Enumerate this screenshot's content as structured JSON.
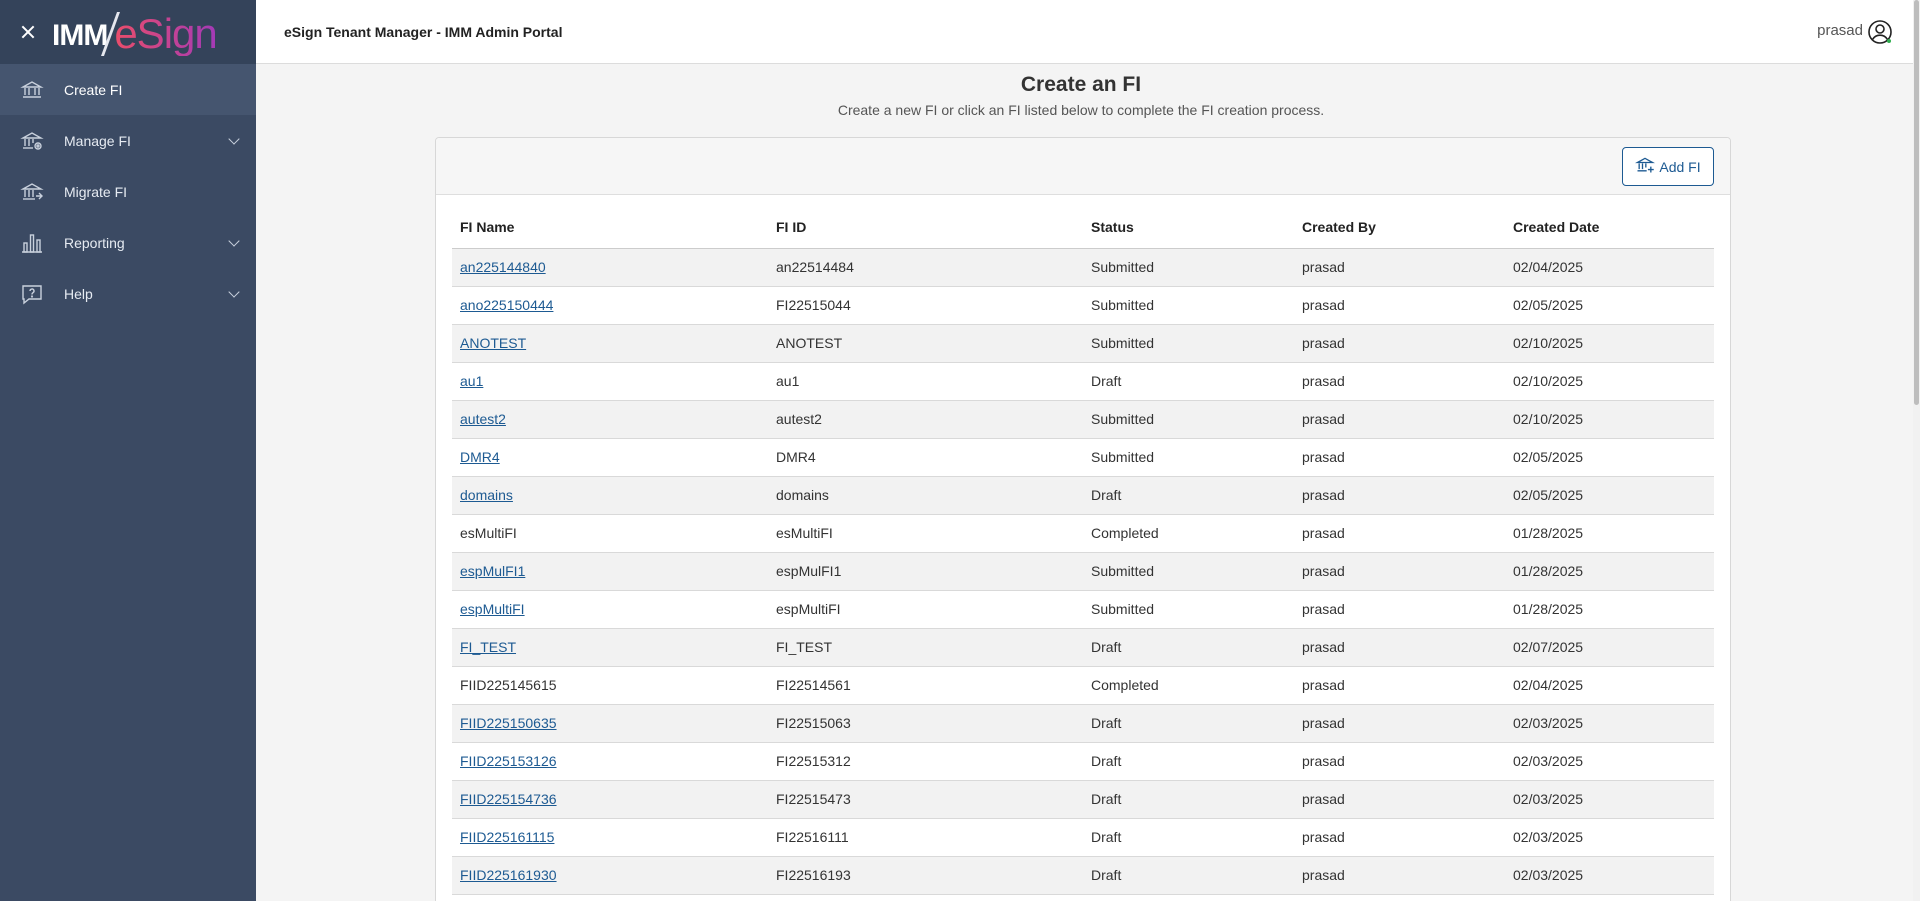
{
  "header": {
    "title": "eSign Tenant Manager - IMM Admin Portal",
    "user": "prasad"
  },
  "logo": {
    "imm": "IMM",
    "esign": "eSign"
  },
  "sidebar": {
    "items": [
      {
        "label": "Create FI",
        "icon": "bank-icon",
        "expandable": false
      },
      {
        "label": "Manage FI",
        "icon": "bank-gear-icon",
        "expandable": true
      },
      {
        "label": "Migrate FI",
        "icon": "bank-arrow-icon",
        "expandable": false
      },
      {
        "label": "Reporting",
        "icon": "bar-chart-icon",
        "expandable": true
      },
      {
        "label": "Help",
        "icon": "help-icon",
        "expandable": true
      }
    ]
  },
  "main": {
    "title": "Create an FI",
    "subtitle": "Create a new FI or click an FI listed below to complete the FI creation process.",
    "add_button": "Add FI"
  },
  "table": {
    "columns": [
      "FI Name",
      "FI ID",
      "Status",
      "Created By",
      "Created Date"
    ],
    "rows": [
      {
        "name": "an225144840",
        "id": "an22514484",
        "status": "Submitted",
        "by": "prasad",
        "date": "02/04/2025",
        "link": true
      },
      {
        "name": "ano225150444",
        "id": "FI22515044",
        "status": "Submitted",
        "by": "prasad",
        "date": "02/05/2025",
        "link": true
      },
      {
        "name": "ANOTEST",
        "id": "ANOTEST",
        "status": "Submitted",
        "by": "prasad",
        "date": "02/10/2025",
        "link": true
      },
      {
        "name": "au1",
        "id": "au1",
        "status": "Draft",
        "by": "prasad",
        "date": "02/10/2025",
        "link": true
      },
      {
        "name": "autest2",
        "id": "autest2",
        "status": "Submitted",
        "by": "prasad",
        "date": "02/10/2025",
        "link": true
      },
      {
        "name": "DMR4",
        "id": "DMR4",
        "status": "Submitted",
        "by": "prasad",
        "date": "02/05/2025",
        "link": true
      },
      {
        "name": "domains",
        "id": "domains",
        "status": "Draft",
        "by": "prasad",
        "date": "02/05/2025",
        "link": true
      },
      {
        "name": "esMultiFI",
        "id": "esMultiFI",
        "status": "Completed",
        "by": "prasad",
        "date": "01/28/2025",
        "link": false
      },
      {
        "name": "espMulFI1",
        "id": "espMulFI1",
        "status": "Submitted",
        "by": "prasad",
        "date": "01/28/2025",
        "link": true
      },
      {
        "name": "espMultiFI",
        "id": "espMultiFI",
        "status": "Submitted",
        "by": "prasad",
        "date": "01/28/2025",
        "link": true
      },
      {
        "name": "FI_TEST",
        "id": "FI_TEST",
        "status": "Draft",
        "by": "prasad",
        "date": "02/07/2025",
        "link": true
      },
      {
        "name": "FIID225145615",
        "id": "FI22514561",
        "status": "Completed",
        "by": "prasad",
        "date": "02/04/2025",
        "link": false
      },
      {
        "name": "FIID225150635",
        "id": "FI22515063",
        "status": "Draft",
        "by": "prasad",
        "date": "02/03/2025",
        "link": true
      },
      {
        "name": "FIID225153126",
        "id": "FI22515312",
        "status": "Draft",
        "by": "prasad",
        "date": "02/03/2025",
        "link": true
      },
      {
        "name": "FIID225154736",
        "id": "FI22515473",
        "status": "Draft",
        "by": "prasad",
        "date": "02/03/2025",
        "link": true
      },
      {
        "name": "FIID225161115",
        "id": "FI22516111",
        "status": "Draft",
        "by": "prasad",
        "date": "02/03/2025",
        "link": true
      },
      {
        "name": "FIID225161930",
        "id": "FI22516193",
        "status": "Draft",
        "by": "prasad",
        "date": "02/03/2025",
        "link": true
      }
    ]
  },
  "colors": {
    "sidebar": "#3b4a63",
    "link": "#1d5a92",
    "accent": "#c0369d"
  }
}
